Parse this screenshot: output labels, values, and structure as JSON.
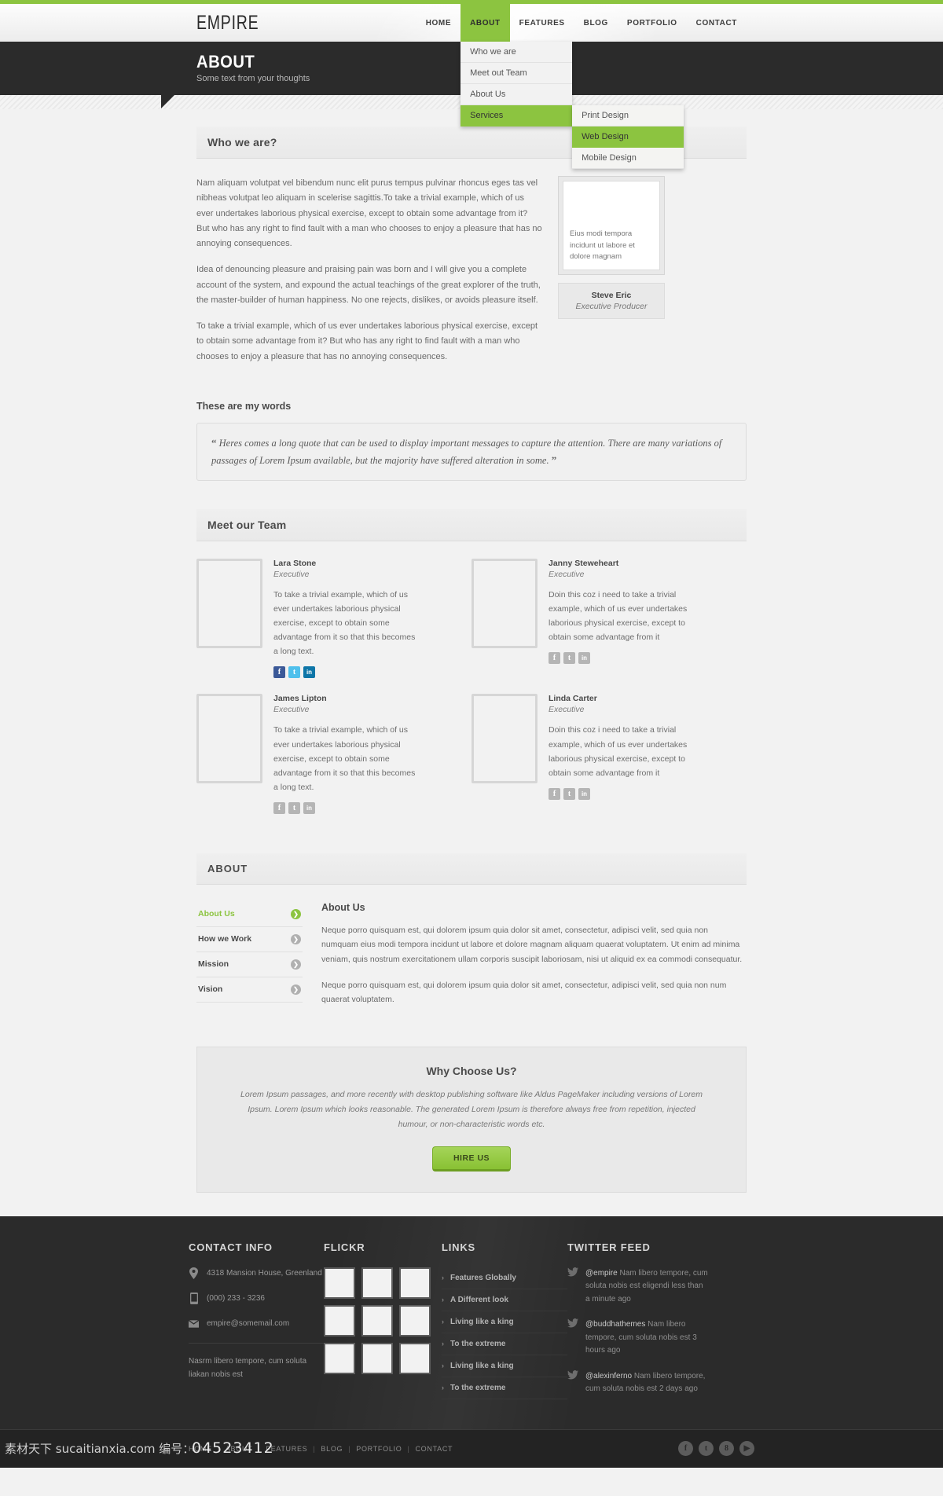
{
  "brand": {
    "logo": "EMPIRE"
  },
  "nav": {
    "items": [
      {
        "label": "HOME",
        "active": false
      },
      {
        "label": "ABOUT",
        "active": true
      },
      {
        "label": "FEATURES",
        "active": false
      },
      {
        "label": "BLOG",
        "active": false
      },
      {
        "label": "PORTFOLIO",
        "active": false
      },
      {
        "label": "CONTACT",
        "active": false
      }
    ],
    "dropdown": [
      {
        "label": "Who we are",
        "highlight": false
      },
      {
        "label": "Meet out Team",
        "highlight": false
      },
      {
        "label": "About Us",
        "highlight": false
      },
      {
        "label": "Services",
        "highlight": true
      }
    ],
    "submenu": [
      {
        "label": "Print Design",
        "highlight": false
      },
      {
        "label": "Web Design",
        "highlight": true
      },
      {
        "label": "Mobile Design",
        "highlight": false
      }
    ]
  },
  "banner": {
    "title": "ABOUT",
    "subtitle": "Some text from your thoughts"
  },
  "who": {
    "heading": "Who we are?",
    "paragraphs": [
      "Nam aliquam volutpat vel bibendum nunc elit purus tempus pulvinar rhoncus eges tas vel nibheas volutpat leo aliquam in scelerise sagittis.To take a trivial example, which of us ever undertakes laborious physical exercise, except to obtain some advantage from it? But who has any right to find fault with a man who chooses to enjoy a pleasure that has no annoying consequences.",
      "Idea of denouncing pleasure and praising pain was born and I will give you a complete account of the system, and expound the actual teachings of the great explorer of the truth, the master-builder of human happiness. No one rejects, dislikes, or avoids pleasure itself.",
      "To take a trivial example, which of us ever undertakes laborious physical exercise, except to obtain some advantage from it? But who has any right to find fault with a man who chooses to enjoy a pleasure that has no annoying consequences."
    ],
    "thumb_caption": "Eius modi tempora incidunt ut labore et dolore magnam",
    "author_name": "Steve Eric",
    "author_role": "Executive Producer"
  },
  "words": {
    "subtitle": "These are my words",
    "open_quote": "“",
    "close_quote": "”",
    "quote": "Heres comes a long quote that can be used to display important messages to capture the attention. There are many variations of passages of Lorem Ipsum available, but the majority have suffered alteration in some."
  },
  "team": {
    "heading": "Meet our Team",
    "members": [
      {
        "name": "Lara Stone",
        "role": "Executive",
        "bio": "To take a trivial example, which of us ever undertakes laborious physical exercise, except to obtain some advantage from it so that this becomes a long text.",
        "colored": true
      },
      {
        "name": "Janny Steweheart",
        "role": "Executive",
        "bio": "Doin this coz i need to take a trivial example, which of us ever undertakes laborious physical exercise, except to obtain some advantage from it",
        "colored": false
      },
      {
        "name": "James Lipton",
        "role": "Executive",
        "bio": "To take a trivial example, which of us ever undertakes laborious physical exercise, except to obtain some advantage from it so that this becomes a long text.",
        "colored": false
      },
      {
        "name": "Linda Carter",
        "role": "Executive",
        "bio": "Doin this coz i need to take a trivial example, which of us ever undertakes laborious physical exercise, except to obtain some advantage from it",
        "colored": false
      }
    ],
    "social_labels": {
      "facebook": "f",
      "twitter": "t",
      "linkedin": "in"
    }
  },
  "about_block": {
    "heading": "ABOUT",
    "tabs": [
      {
        "label": "About Us",
        "active": true
      },
      {
        "label": "How we Work",
        "active": false
      },
      {
        "label": "Mission",
        "active": false
      },
      {
        "label": "Vision",
        "active": false
      }
    ],
    "panel_title": "About Us",
    "panel_paragraphs": [
      "Neque porro quisquam est, qui dolorem ipsum quia dolor sit amet, consectetur, adipisci velit, sed quia non numquam eius modi tempora incidunt ut labore et dolore magnam aliquam quaerat voluptatem. Ut enim ad minima veniam, quis nostrum exercitationem ullam corporis suscipit laboriosam, nisi ut aliquid ex ea commodi consequatur.",
      "Neque porro quisquam est, qui dolorem ipsum quia dolor sit amet, consectetur, adipisci velit, sed quia non num quaerat voluptatem."
    ],
    "arrow_glyph": "❯"
  },
  "cta": {
    "title": "Why Choose Us?",
    "text": "Lorem Ipsum passages, and more recently with desktop publishing software like Aldus PageMaker including versions of Lorem Ipsum. Lorem Ipsum which looks reasonable. The generated Lorem Ipsum is therefore always free from repetition, injected humour, or non-characteristic words etc.",
    "button": "HIRE US"
  },
  "footer": {
    "contact": {
      "heading": "CONTACT INFO",
      "address": "4318 Mansion House, Greenland",
      "phone": "(000) 233 - 3236",
      "email": "empire@somemail.com",
      "note": "Nasrm libero tempore, cum soluta liakan nobis est"
    },
    "flickr": {
      "heading": "FLICKR",
      "count": 9
    },
    "links": {
      "heading": "LINKS",
      "items": [
        "Features Globally",
        "A Different look",
        "Living like a king",
        "To the extreme",
        "Living like a king",
        "To the extreme"
      ],
      "chevron": "›"
    },
    "twitter": {
      "heading": "TWITTER FEED",
      "tweets": [
        {
          "handle": "@empire",
          "text": "Nam libero tempore, cum soluta nobis est eligendi",
          "time": "less than a minute ago"
        },
        {
          "handle": "@buddhathemes",
          "text": "Nam libero tempore, cum soluta nobis est",
          "time": "3 hours ago"
        },
        {
          "handle": "@alexinferno",
          "text": "Nam libero tempore, cum soluta nobis est",
          "time": "2 days ago"
        }
      ]
    }
  },
  "bottom": {
    "nav": [
      "HOME",
      "ABOUT",
      "FEATURES",
      "BLOG",
      "PORTFOLIO",
      "CONTACT"
    ],
    "separator": "|",
    "socials": [
      {
        "name": "facebook",
        "glyph": "f"
      },
      {
        "name": "twitter",
        "glyph": "t"
      },
      {
        "name": "google-plus",
        "glyph": "8"
      },
      {
        "name": "youtube",
        "glyph": "▶"
      }
    ]
  },
  "watermark": {
    "left": "素材天下 sucaitianxia.com   编号：",
    "mid": "04523412"
  },
  "colors": {
    "accent": "#8cc440",
    "dark": "#2b2b2b",
    "page": "#f2f2f2"
  }
}
